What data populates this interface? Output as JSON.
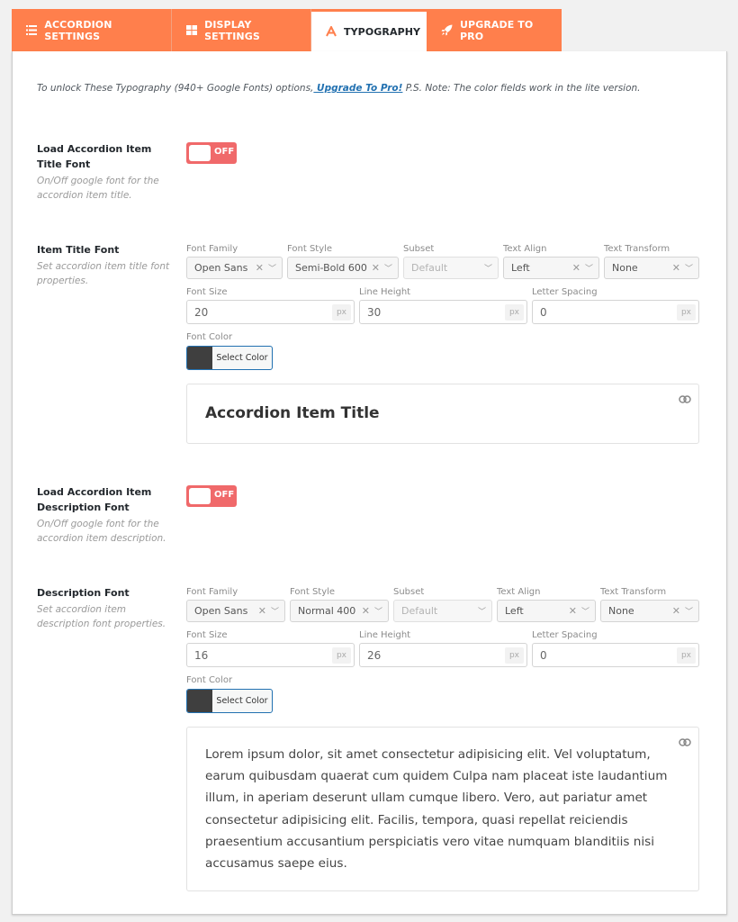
{
  "tabs": [
    {
      "label": "ACCORDION SETTINGS",
      "icon": "list-icon",
      "active": false
    },
    {
      "label": "DISPLAY SETTINGS",
      "icon": "grid-icon",
      "active": false
    },
    {
      "label": "TYPOGRAPHY",
      "icon": "font-icon",
      "active": true
    },
    {
      "label": "UPGRADE TO PRO",
      "icon": "rocket-icon",
      "active": false
    }
  ],
  "notice": {
    "before": "To unlock These Typography (940+ Google Fonts) options,",
    "link": " Upgrade To Pro!",
    "after": " P.S. Note: The color fields work in the lite version."
  },
  "title_toggle": {
    "label": "Load Accordion Item Title Font",
    "description": "On/Off google font for the accordion item title.",
    "state": "OFF"
  },
  "title_font": {
    "label": "Item Title Font",
    "description": "Set accordion item title font properties.",
    "font_family": {
      "label": "Font Family",
      "value": "Open Sans"
    },
    "font_style": {
      "label": "Font Style",
      "value": "Semi-Bold 600"
    },
    "subset": {
      "label": "Subset",
      "value": "Default"
    },
    "text_align": {
      "label": "Text Align",
      "value": "Left"
    },
    "text_transform": {
      "label": "Text Transform",
      "value": "None"
    },
    "font_size": {
      "label": "Font Size",
      "value": "20",
      "unit": "px"
    },
    "line_height": {
      "label": "Line Height",
      "value": "30",
      "unit": "px"
    },
    "letter_spacing": {
      "label": "Letter Spacing",
      "value": "0",
      "unit": "px"
    },
    "font_color": {
      "label": "Font Color",
      "button": "Select Color",
      "color": "#3f3f3f"
    },
    "preview": "Accordion Item Title"
  },
  "desc_toggle": {
    "label": "Load Accordion Item Description Font",
    "description": "On/Off google font for the accordion item description.",
    "state": "OFF"
  },
  "desc_font": {
    "label": "Description Font",
    "description": "Set accordion item description font properties.",
    "font_family": {
      "label": "Font Family",
      "value": "Open Sans"
    },
    "font_style": {
      "label": "Font Style",
      "value": "Normal 400"
    },
    "subset": {
      "label": "Subset",
      "value": "Default"
    },
    "text_align": {
      "label": "Text Align",
      "value": "Left"
    },
    "text_transform": {
      "label": "Text Transform",
      "value": "None"
    },
    "font_size": {
      "label": "Font Size",
      "value": "16",
      "unit": "px"
    },
    "line_height": {
      "label": "Line Height",
      "value": "26",
      "unit": "px"
    },
    "letter_spacing": {
      "label": "Letter Spacing",
      "value": "0",
      "unit": "px"
    },
    "font_color": {
      "label": "Font Color",
      "button": "Select Color",
      "color": "#3f3f3f"
    },
    "preview": "Lorem ipsum dolor, sit amet consectetur adipisicing elit. Vel voluptatum, earum quibusdam quaerat cum quidem Culpa nam placeat iste laudantium illum, in aperiam deserunt ullam cumque libero. Vero, aut pariatur amet consectetur adipisicing elit. Facilis, tempora, quasi repellat reiciendis praesentium accusantium perspiciatis vero vitae numquam blanditiis nisi accusamus saepe eius."
  },
  "colors": {
    "accent": "#ff7f4c",
    "toggle_off": "#f0696a",
    "link": "#2271b1"
  }
}
